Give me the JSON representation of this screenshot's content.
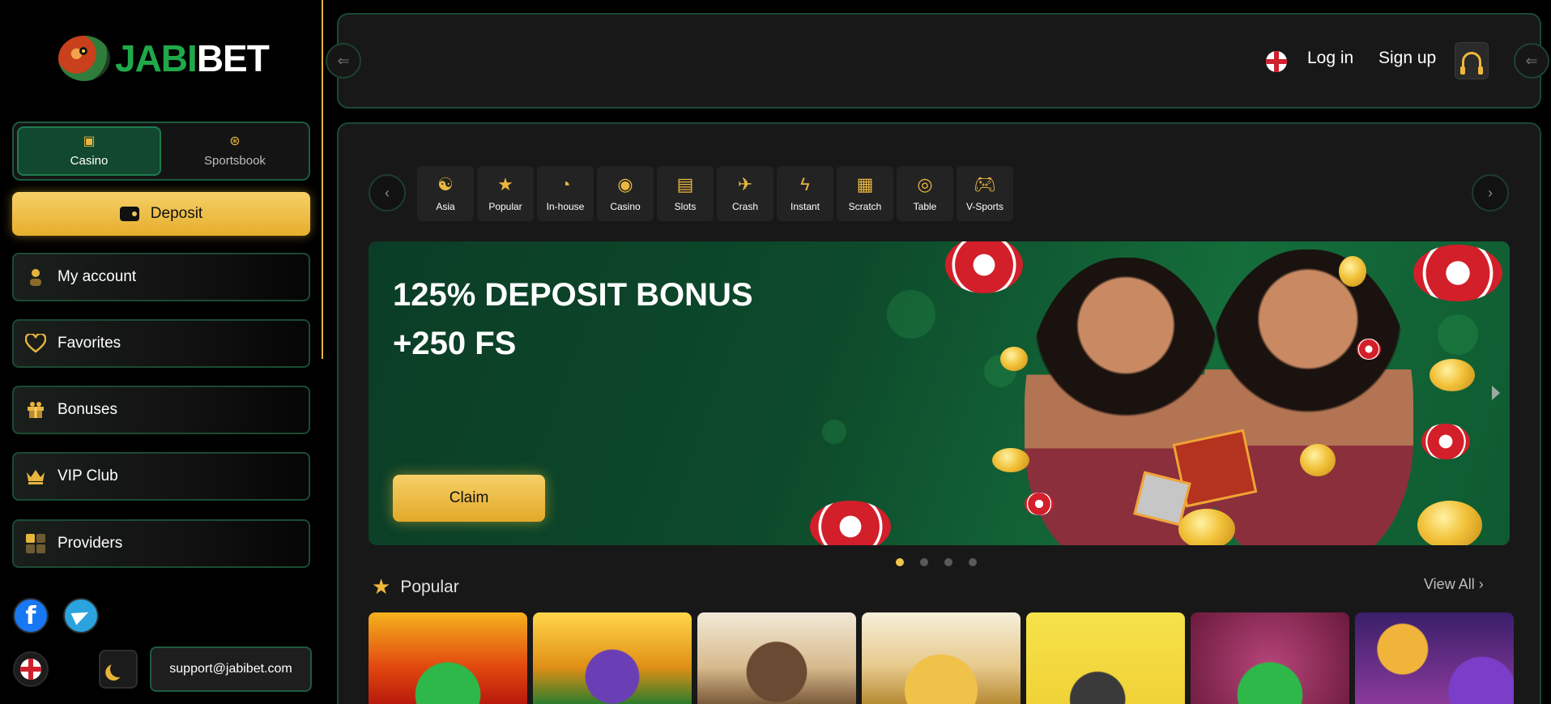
{
  "brand": {
    "part1": "JABI",
    "part2": "BET",
    "accent": "#1fa94a",
    "gold": "#e8b53a"
  },
  "sidebar": {
    "modes": [
      {
        "label": "Casino",
        "icon": "casino-card-icon",
        "active": true
      },
      {
        "label": "Sportsbook",
        "icon": "basketball-icon",
        "active": false
      }
    ],
    "deposit_label": "Deposit",
    "items": [
      {
        "label": "My account",
        "icon": "user-icon"
      },
      {
        "label": "Favorites",
        "icon": "heart-icon"
      },
      {
        "label": "Bonuses",
        "icon": "gift-icon"
      },
      {
        "label": "VIP Club",
        "icon": "crown-icon"
      },
      {
        "label": "Providers",
        "icon": "grid-icon"
      }
    ],
    "support_email": "support@jabibet.com"
  },
  "header": {
    "login": "Log in",
    "signup": "Sign up"
  },
  "categories": [
    {
      "label": "Asia",
      "icon": "yin-yang-icon"
    },
    {
      "label": "Popular",
      "icon": "star-icon"
    },
    {
      "label": "In-house",
      "icon": "gauge-icon"
    },
    {
      "label": "Casino",
      "icon": "roulette-icon"
    },
    {
      "label": "Slots",
      "icon": "slot-machine-icon"
    },
    {
      "label": "Crash",
      "icon": "plane-icon"
    },
    {
      "label": "Instant",
      "icon": "lightning-icon"
    },
    {
      "label": "Scratch",
      "icon": "ticket-icon"
    },
    {
      "label": "Table",
      "icon": "poker-chips-icon"
    },
    {
      "label": "V-Sports",
      "icon": "gamepad-icon"
    }
  ],
  "banner": {
    "line1": "125% DEPOSIT BONUS",
    "line2": "+250 FS",
    "cta": "Claim",
    "slides": 4,
    "active_slide": 1
  },
  "popular": {
    "title": "Popular",
    "view_all": "View All",
    "tiles": 7
  }
}
